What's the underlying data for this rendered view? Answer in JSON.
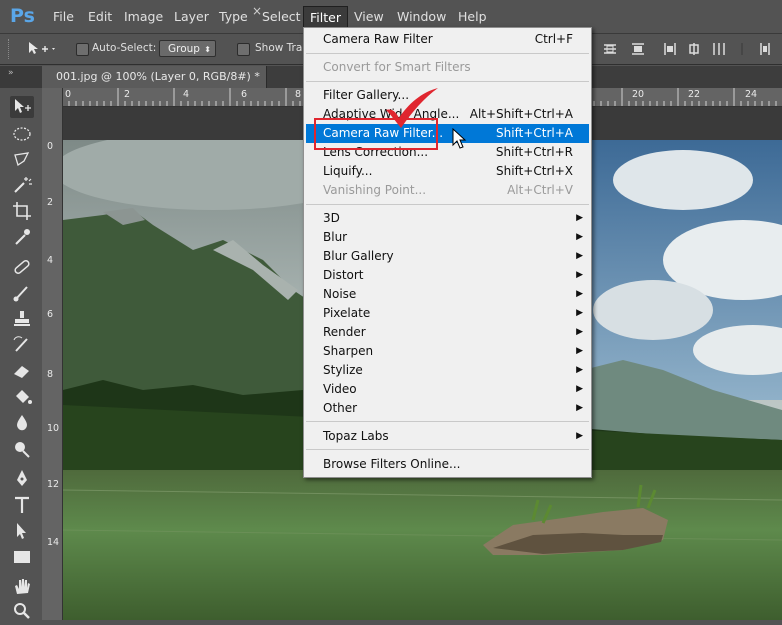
{
  "app": {
    "logo": "Ps",
    "accent": "#5aa6e8"
  },
  "menubar": {
    "items": [
      "File",
      "Edit",
      "Image",
      "Layer",
      "Type",
      "Select",
      "Filter",
      "View",
      "Window",
      "Help"
    ],
    "active": "Filter"
  },
  "options": {
    "auto_select_label": "Auto-Select:",
    "group_value": "Group",
    "show_transform_label": "Show Tran"
  },
  "document": {
    "tab_title": "001.jpg @ 100% (Layer 0, RGB/8#) *",
    "close": "×"
  },
  "rulers": {
    "top": [
      "0",
      "2",
      "4",
      "6",
      "8",
      "10",
      "12",
      "14",
      "16",
      "18",
      "20",
      "22",
      "24"
    ],
    "left": [
      "0",
      "2",
      "4",
      "6",
      "8",
      "10",
      "12",
      "14"
    ]
  },
  "filter_menu": {
    "items": [
      {
        "label": "Camera Raw Filter",
        "shortcut": "Ctrl+F",
        "disabled": false
      },
      {
        "label": "Convert for Smart Filters",
        "shortcut": "",
        "disabled": true
      },
      {
        "label": "Filter Gallery...",
        "shortcut": "",
        "disabled": false
      },
      {
        "label": "Adaptive Wide Angle...",
        "shortcut": "Alt+Shift+Ctrl+A",
        "disabled": false
      },
      {
        "label": "Camera Raw Filter...",
        "shortcut": "Shift+Ctrl+A",
        "disabled": false,
        "highlighted": true
      },
      {
        "label": "Lens Correction...",
        "shortcut": "Shift+Ctrl+R",
        "disabled": false
      },
      {
        "label": "Liquify...",
        "shortcut": "Shift+Ctrl+X",
        "disabled": false
      },
      {
        "label": "Vanishing Point...",
        "shortcut": "Alt+Ctrl+V",
        "disabled": true
      },
      {
        "label": "3D",
        "submenu": true
      },
      {
        "label": "Blur",
        "submenu": true
      },
      {
        "label": "Blur Gallery",
        "submenu": true
      },
      {
        "label": "Distort",
        "submenu": true
      },
      {
        "label": "Noise",
        "submenu": true
      },
      {
        "label": "Pixelate",
        "submenu": true
      },
      {
        "label": "Render",
        "submenu": true
      },
      {
        "label": "Sharpen",
        "submenu": true
      },
      {
        "label": "Stylize",
        "submenu": true
      },
      {
        "label": "Video",
        "submenu": true
      },
      {
        "label": "Other",
        "submenu": true
      },
      {
        "label": "Topaz Labs",
        "submenu": true
      },
      {
        "label": "Browse Filters Online..."
      }
    ],
    "highlight_color": "#0078d7",
    "submenu_arrow": "▶"
  },
  "annotation": {
    "box_color": "#e0262f",
    "check_color": "#e0262f"
  }
}
